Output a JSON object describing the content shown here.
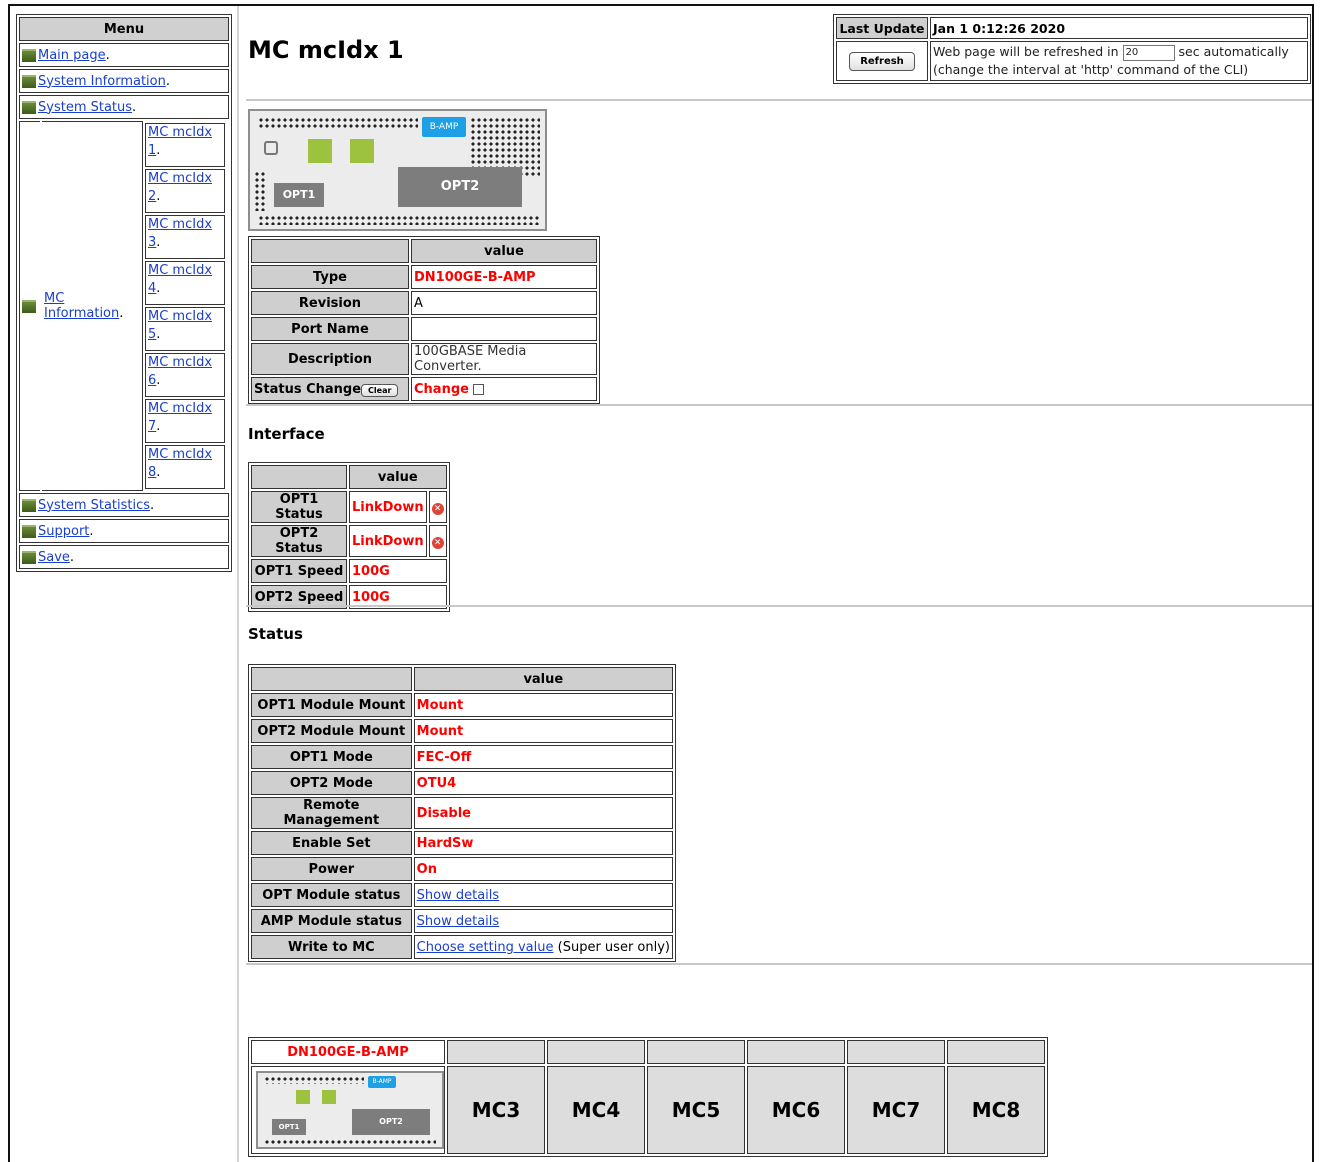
{
  "menu": {
    "header": "Menu",
    "items": {
      "main": "Main page",
      "sysinfo": "System Information",
      "sysstatus": "System Status",
      "mcinfo": "MC Information",
      "sysstats": "System Statistics",
      "support": "Support",
      "save": "Save"
    },
    "mc_links": [
      "MC mcIdx 1",
      "MC mcIdx 2",
      "MC mcIdx 3",
      "MC mcIdx 4",
      "MC mcIdx 5",
      "MC mcIdx 6",
      "MC mcIdx 7",
      "MC mcIdx 8"
    ]
  },
  "update": {
    "label": "Last Update",
    "time": "Jan 1 0:12:26 2020",
    "refresh_label": "Refresh",
    "msg_pre": "Web page will be refreshed in",
    "interval": "20",
    "msg_post": "sec automatically",
    "note": "(change the interval at 'http' command of the CLI)"
  },
  "page_title": "MC mcIdx 1",
  "device_labels": {
    "opt1": "OPT1",
    "opt2": "OPT2",
    "bamp": "B-AMP"
  },
  "info": {
    "col": "value",
    "type_label": "Type",
    "type_value": "DN100GE-B-AMP",
    "rev_label": "Revision",
    "rev_value": "A",
    "port_label": "Port Name",
    "port_value": "",
    "desc_label": "Description",
    "desc_value": "100GBASE Media Converter.",
    "sc_label": "Status Change",
    "clear_label": "Clear",
    "sc_value": "Change"
  },
  "interface": {
    "title": "Interface",
    "col": "value",
    "rows": [
      {
        "label": "OPT1 Status",
        "value": "LinkDown"
      },
      {
        "label": "OPT2 Status",
        "value": "LinkDown"
      },
      {
        "label": "OPT1 Speed",
        "value": "100G"
      },
      {
        "label": "OPT2 Speed",
        "value": "100G"
      }
    ]
  },
  "status": {
    "title": "Status",
    "col": "value",
    "rows": [
      {
        "label": "OPT1 Module Mount",
        "value": "Mount"
      },
      {
        "label": "OPT2 Module Mount",
        "value": "Mount"
      },
      {
        "label": "OPT1 Mode",
        "value": "FEC-Off"
      },
      {
        "label": "OPT2 Mode",
        "value": "OTU4"
      },
      {
        "label": "Remote Management",
        "value": "Disable"
      },
      {
        "label": "Enable Set",
        "value": "HardSw"
      },
      {
        "label": "Power",
        "value": "On"
      }
    ],
    "opt_label": "OPT Module status",
    "opt_link": "Show details",
    "amp_label": "AMP Module status",
    "amp_link": "Show details",
    "write_label": "Write to MC",
    "write_link": "Choose setting value",
    "write_note": "(Super user only)"
  },
  "chassis": {
    "slot1_name": "DN100GE-B-AMP",
    "slots": [
      "MC3",
      "MC4",
      "MC5",
      "MC6",
      "MC7",
      "MC8"
    ]
  }
}
